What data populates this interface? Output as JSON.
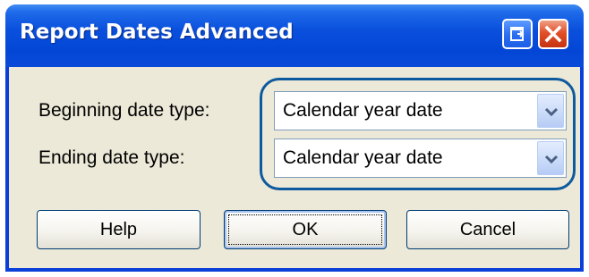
{
  "window": {
    "title": "Report Dates Advanced",
    "title_buttons": [
      "help-icon",
      "close-icon"
    ]
  },
  "fields": {
    "beginning_label": "Beginning date type:",
    "beginning_value": "Calendar year date",
    "ending_label": "Ending date type:",
    "ending_value": "Calendar year date"
  },
  "buttons": {
    "help": "Help",
    "ok": "OK",
    "cancel": "Cancel"
  },
  "colors": {
    "titlebar": "#0a50dd",
    "dialog_background": "#ece9d8",
    "highlight_ring": "#0e5a9e",
    "close_button": "#e0502a"
  }
}
